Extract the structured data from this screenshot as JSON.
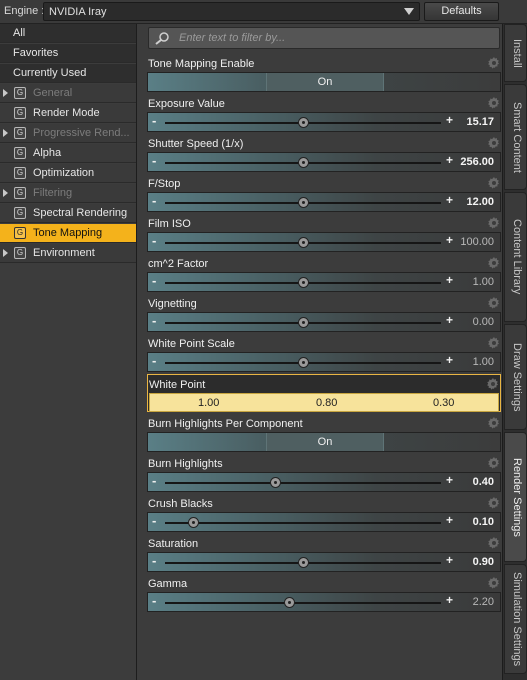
{
  "engine": {
    "label": "Engine :",
    "value": "NVIDIA Iray",
    "defaults_label": "Defaults"
  },
  "filter": {
    "placeholder": "Enter text to filter by..."
  },
  "sidebar": {
    "items": [
      {
        "label": "All",
        "kind": "plain"
      },
      {
        "label": "Favorites",
        "kind": "plain"
      },
      {
        "label": "Currently Used",
        "kind": "plain"
      },
      {
        "label": "General",
        "kind": "group",
        "expandable": true,
        "disabled": true
      },
      {
        "label": "Render Mode",
        "kind": "group",
        "expandable": false
      },
      {
        "label": "Progressive Rend...",
        "kind": "group",
        "expandable": true,
        "disabled": true
      },
      {
        "label": "Alpha",
        "kind": "group",
        "expandable": false
      },
      {
        "label": "Optimization",
        "kind": "group",
        "expandable": false
      },
      {
        "label": "Filtering",
        "kind": "group",
        "expandable": true,
        "disabled": true
      },
      {
        "label": "Spectral Rendering",
        "kind": "group",
        "expandable": false
      },
      {
        "label": "Tone Mapping",
        "kind": "group",
        "expandable": false,
        "selected": true
      },
      {
        "label": "Environment",
        "kind": "group",
        "expandable": true
      }
    ]
  },
  "properties": [
    {
      "name": "Tone Mapping Enable",
      "type": "toggle",
      "value": "On"
    },
    {
      "name": "Exposure Value",
      "type": "slider",
      "value": "15.17",
      "position": 0.5,
      "dim": false
    },
    {
      "name": "Shutter Speed (1/x)",
      "type": "slider",
      "value": "256.00",
      "position": 0.5,
      "dim": false
    },
    {
      "name": "F/Stop",
      "type": "slider",
      "value": "12.00",
      "position": 0.5,
      "dim": false
    },
    {
      "name": "Film ISO",
      "type": "slider",
      "value": "100.00",
      "position": 0.5,
      "dim": true
    },
    {
      "name": "cm^2 Factor",
      "type": "slider",
      "value": "1.00",
      "position": 0.5,
      "dim": true
    },
    {
      "name": "Vignetting",
      "type": "slider",
      "value": "0.00",
      "position": 0.5,
      "dim": true
    },
    {
      "name": "White Point Scale",
      "type": "slider",
      "value": "1.00",
      "position": 0.5,
      "dim": true
    },
    {
      "name": "White Point",
      "type": "color",
      "values": [
        "1.00",
        "0.80",
        "0.30"
      ]
    },
    {
      "name": "Burn Highlights Per Component",
      "type": "toggle",
      "value": "On"
    },
    {
      "name": "Burn Highlights",
      "type": "slider",
      "value": "0.40",
      "position": 0.4,
      "dim": false
    },
    {
      "name": "Crush Blacks",
      "type": "slider",
      "value": "0.10",
      "position": 0.1,
      "dim": false
    },
    {
      "name": "Saturation",
      "type": "slider",
      "value": "0.90",
      "position": 0.5,
      "dim": false
    },
    {
      "name": "Gamma",
      "type": "slider",
      "value": "2.20",
      "position": 0.45,
      "dim": true
    }
  ],
  "tabs": [
    {
      "label": "Install",
      "active": false
    },
    {
      "label": "Smart Content",
      "active": false
    },
    {
      "label": "Content Library",
      "active": false
    },
    {
      "label": "Draw Settings",
      "active": false
    },
    {
      "label": "Render Settings",
      "active": true
    },
    {
      "label": "Simulation Settings",
      "active": false
    }
  ],
  "colors": {
    "accent": "#f4b21b",
    "highlight_border": "#e9b543",
    "color_field": "#f7e39b"
  }
}
